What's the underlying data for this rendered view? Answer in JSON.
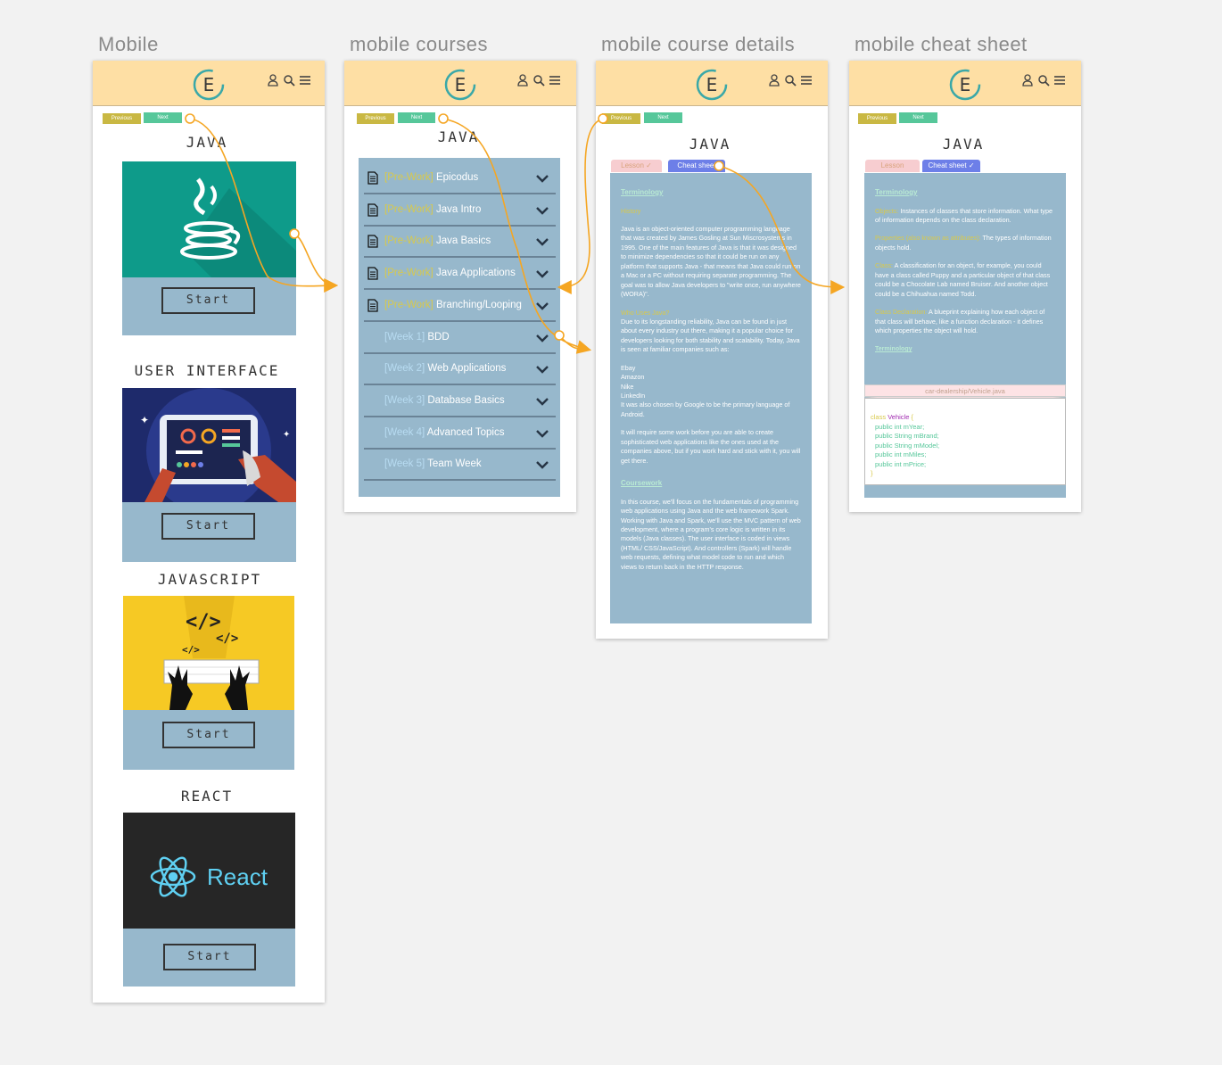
{
  "frames": {
    "mobile": "Mobile",
    "courses": "mobile courses",
    "details": "mobile course details",
    "cheatsheet": "mobile cheat sheet"
  },
  "header": {
    "logo_letter": "E",
    "icons": [
      "user-icon",
      "search-icon",
      "menu-icon"
    ],
    "bg_color": "#fedfa4"
  },
  "nav": {
    "previous": "Previous",
    "next": "Next"
  },
  "mobile": {
    "cards": [
      {
        "title": "JAVA",
        "start": "Start"
      },
      {
        "title": "USER INTERFACE",
        "start": "Start"
      },
      {
        "title": "JAVASCRIPT",
        "start": "Start"
      },
      {
        "title": "REACT",
        "start": "Start",
        "logo_text": "React"
      }
    ]
  },
  "courses": {
    "title": "JAVA",
    "items": [
      {
        "tag": "[Pre-Work]",
        "label": "Epicodus",
        "doc": true
      },
      {
        "tag": "[Pre-Work]",
        "label": "Java Intro",
        "doc": true
      },
      {
        "tag": "[Pre-Work]",
        "label": "Java Basics",
        "doc": true
      },
      {
        "tag": "[Pre-Work]",
        "label": "Java Applications",
        "doc": true
      },
      {
        "tag": "[Pre-Work]",
        "label": "Branching/Looping",
        "doc": true
      },
      {
        "tag": "[Week 1]",
        "label": "BDD",
        "doc": false
      },
      {
        "tag": "[Week 2]",
        "label": "Web Applications",
        "doc": false
      },
      {
        "tag": "[Week 3]",
        "label": "Database Basics",
        "doc": false
      },
      {
        "tag": "[Week 4]",
        "label": "Advanced Topics",
        "doc": false
      },
      {
        "tag": "[Week 5]",
        "label": "Team Week",
        "doc": false
      }
    ]
  },
  "details": {
    "title": "JAVA",
    "tab_lesson": "Lesson",
    "tab_cheat": "Cheat sheet",
    "section1_link": "Terminology",
    "history_label": "History",
    "history_text": "Java is an object-oriented computer programming language that was created by James Gosling at Sun Miscrosystems in 1995. One of the main features of Java is that it was designed to minimize dependencies so that it could be run on any platform that supports Java - that means that Java could run on a Mac or a PC without requiring separate programming. The goal was to allow Java developers to \"write once, run anywhere (WORA)\".",
    "who_label": "Who Uses Java?",
    "who_text": "Due to its longstanding reliability, Java can be found in just about every industry out there, making it a popular choice for developers looking for both stability and scalability. Today, Java is seen at familiar companies such as:",
    "companies": [
      "Ebay",
      "Amazon",
      "Nike",
      "LinkedIn"
    ],
    "android_text": "It was also chosen by Google to be the primary language of Android.",
    "work_text": "It will require some work before you are able to create sophisticated web applications like the ones used at the companies above, but if you work hard and stick with it, you will get there.",
    "coursework_link": "Coursework",
    "coursework_text": "In this course, we'll focus on the fundamentals of programming web applications using Java and the web framework Spark. Working with Java and Spark, we'll use the MVC pattern of web development, where a program's core logic is written in its models (Java classes). The user interface is coded in views (HTML/ CSS/JavaScript). And controllers (Spark) will handle web requests, defining what model code to run and which views to return back in the HTTP response."
  },
  "cheatsheet": {
    "title": "JAVA",
    "tab_lesson": "Lesson",
    "tab_cheat": "Cheat sheet",
    "terminology_link": "Terminology",
    "terms": [
      {
        "term": "Objects:",
        "def": "Instances of classes that store information. What type of information depends on the class declaration."
      },
      {
        "term": "Properties (also known as attributes):",
        "def": "The types of information objects hold."
      },
      {
        "term": "Class:",
        "def": "A classification for an object, for example, you could have a class called Puppy and a particular object of that class could be a Chocolate Lab named Bruiser. And another object could be a Chihuahua named Todd."
      },
      {
        "term": "Class Declaration:",
        "def": "A blueprint explaining how each object of that class will behave, like a function declaration - it defines which properties the object will hold."
      }
    ],
    "terminology_link2": "Terminology",
    "file_name": "car-dealership/Vehicle.java",
    "code": {
      "kw": "class",
      "name": "Vehicle",
      "brace_open": "{",
      "fields": [
        "public int mYear;",
        "public String mBrand;",
        "public String mModel;",
        "public int mMiles;",
        "public int mPrice;"
      ],
      "brace_close": "}"
    }
  },
  "colors": {
    "accent_orange": "#f5a623",
    "panel_blue": "#97b8cc",
    "prev_btn": "#c9b843",
    "next_btn": "#56c79a",
    "teal_logo": "#3aa8a8"
  }
}
